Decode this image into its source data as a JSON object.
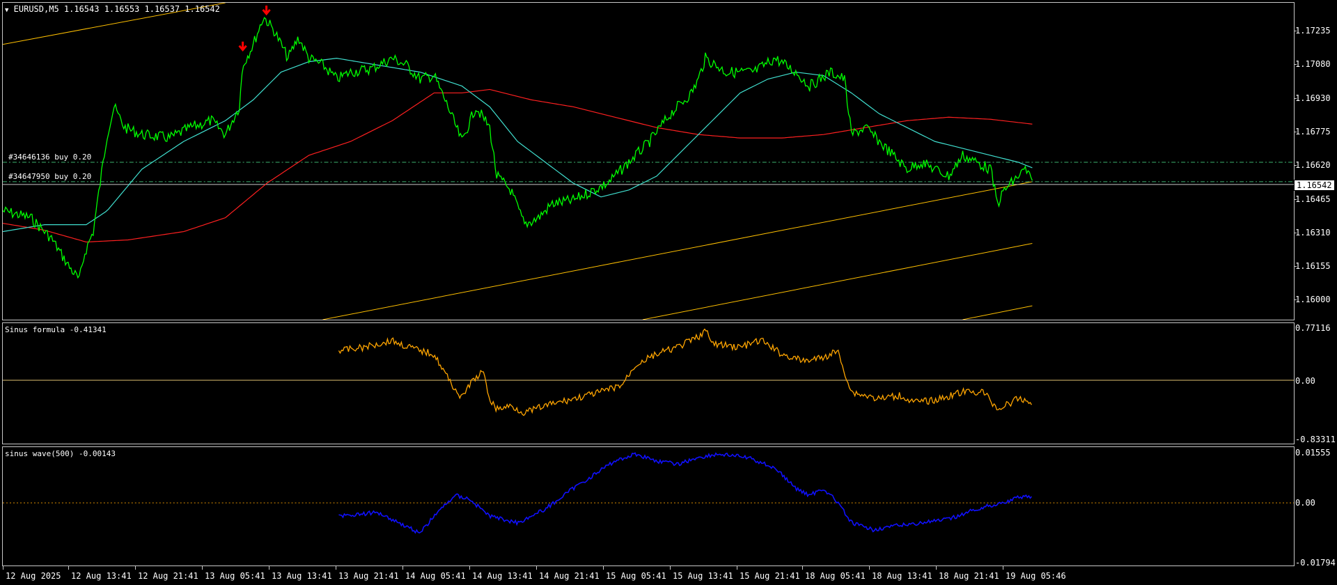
{
  "main": {
    "header": "EURUSD,M5  1.16543 1.16553 1.16537 1.16542",
    "current_price": "1.16542",
    "order_labels": [
      "#34646136 buy 0.20",
      "#34647950 buy 0.20"
    ],
    "y_ticks": [
      "1.17235",
      "1.17080",
      "1.16930",
      "1.16775",
      "1.16620",
      "1.16465",
      "1.16310",
      "1.16155",
      "1.16000"
    ]
  },
  "sinus": {
    "label": "Sinus formula -0.41341",
    "y_ticks": [
      "0.77116",
      "0.00",
      "-0.83311"
    ]
  },
  "wave": {
    "label": "sinus wave(500) -0.00143",
    "y_ticks": [
      "0.01555",
      "0.00",
      "-0.01794"
    ]
  },
  "x_ticks": [
    "12 Aug 2025",
    "12 Aug 13:41",
    "12 Aug 21:41",
    "13 Aug 05:41",
    "13 Aug 13:41",
    "13 Aug 21:41",
    "14 Aug 05:41",
    "14 Aug 13:41",
    "14 Aug 21:41",
    "15 Aug 05:41",
    "15 Aug 13:41",
    "15 Aug 21:41",
    "18 Aug 05:41",
    "18 Aug 13:41",
    "18 Aug 21:41",
    "19 Aug 05:46"
  ],
  "colors": {
    "price": "#00ff00",
    "ma_fast": "#40e0d0",
    "ma_slow": "#ff2020",
    "channel": "#ffc000",
    "sinus": "#ffa500",
    "wave": "#1010ff",
    "arrow": "#ff0000"
  }
}
